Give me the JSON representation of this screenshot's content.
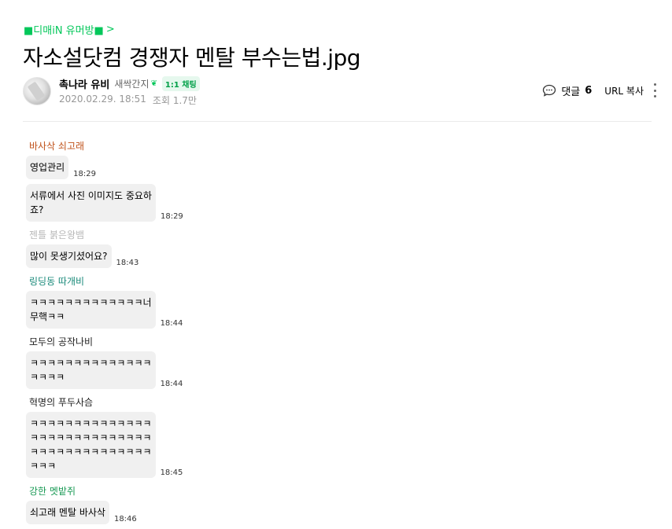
{
  "board": {
    "label": "■디매iN 유머방■",
    "chevron": ">"
  },
  "post": {
    "title": "자소설닷컴 경쟁자 멘탈 부수는법.jpg",
    "author": {
      "nickname": "촉나라 유비",
      "level": "새싹간지",
      "chat_badge": "1:1 채팅"
    },
    "date": "2020.02.29. 18:51",
    "views": "조회 1.7만"
  },
  "tools": {
    "comment_label": "댓글",
    "comment_count": "6",
    "url_copy": "URL 복사"
  },
  "colors": {
    "accent_green": "#03c75a",
    "bubble_bg": "#f0f0f0"
  },
  "messages": [
    {
      "sender": "바사삭 쇠고래",
      "sender_color": "#c0521a",
      "bubbles": [
        {
          "text": "영업관리",
          "time": "18:29"
        },
        {
          "text": "서류에서 사진 이미지도 중요하\n죠?",
          "time": "18:29"
        }
      ]
    },
    {
      "sender": "젠틀 붉은왕뱀",
      "sender_color": "#b8b8b8",
      "bubbles": [
        {
          "text": "많이 못생기셨어요?",
          "time": "18:43"
        }
      ]
    },
    {
      "sender": "링딩동 따개비",
      "sender_color": "#1a8a7a",
      "bubbles": [
        {
          "text": "ㅋㅋㅋㅋㅋㅋㅋㅋㅋㅋㅋㅋㅋ너\n무핵ㅋㅋ",
          "time": "18:44"
        }
      ]
    },
    {
      "sender": "모두의 공작나비",
      "sender_color": "#222222",
      "bubbles": [
        {
          "text": "ㅋㅋㅋㅋㅋㅋㅋㅋㅋㅋㅋㅋㅋㅋ\nㅋㅋㅋㅋ",
          "time": "18:44"
        }
      ]
    },
    {
      "sender": "혁명의 푸두사슴",
      "sender_color": "#222222",
      "bubbles": [
        {
          "text": "ㅋㅋㅋㅋㅋㅋㅋㅋㅋㅋㅋㅋㅋㅋ\nㅋㅋㅋㅋㅋㅋㅋㅋㅋㅋㅋㅋㅋㅋ\nㅋㅋㅋㅋㅋㅋㅋㅋㅋㅋㅋㅋㅋㅋ\nㅋㅋㅋ",
          "time": "18:45"
        }
      ]
    },
    {
      "sender": "강한 멧밭쥐",
      "sender_color": "#1a9a55",
      "bubbles": [
        {
          "text": "쇠고래 멘탈 바사삭",
          "time": "18:46"
        }
      ]
    }
  ]
}
